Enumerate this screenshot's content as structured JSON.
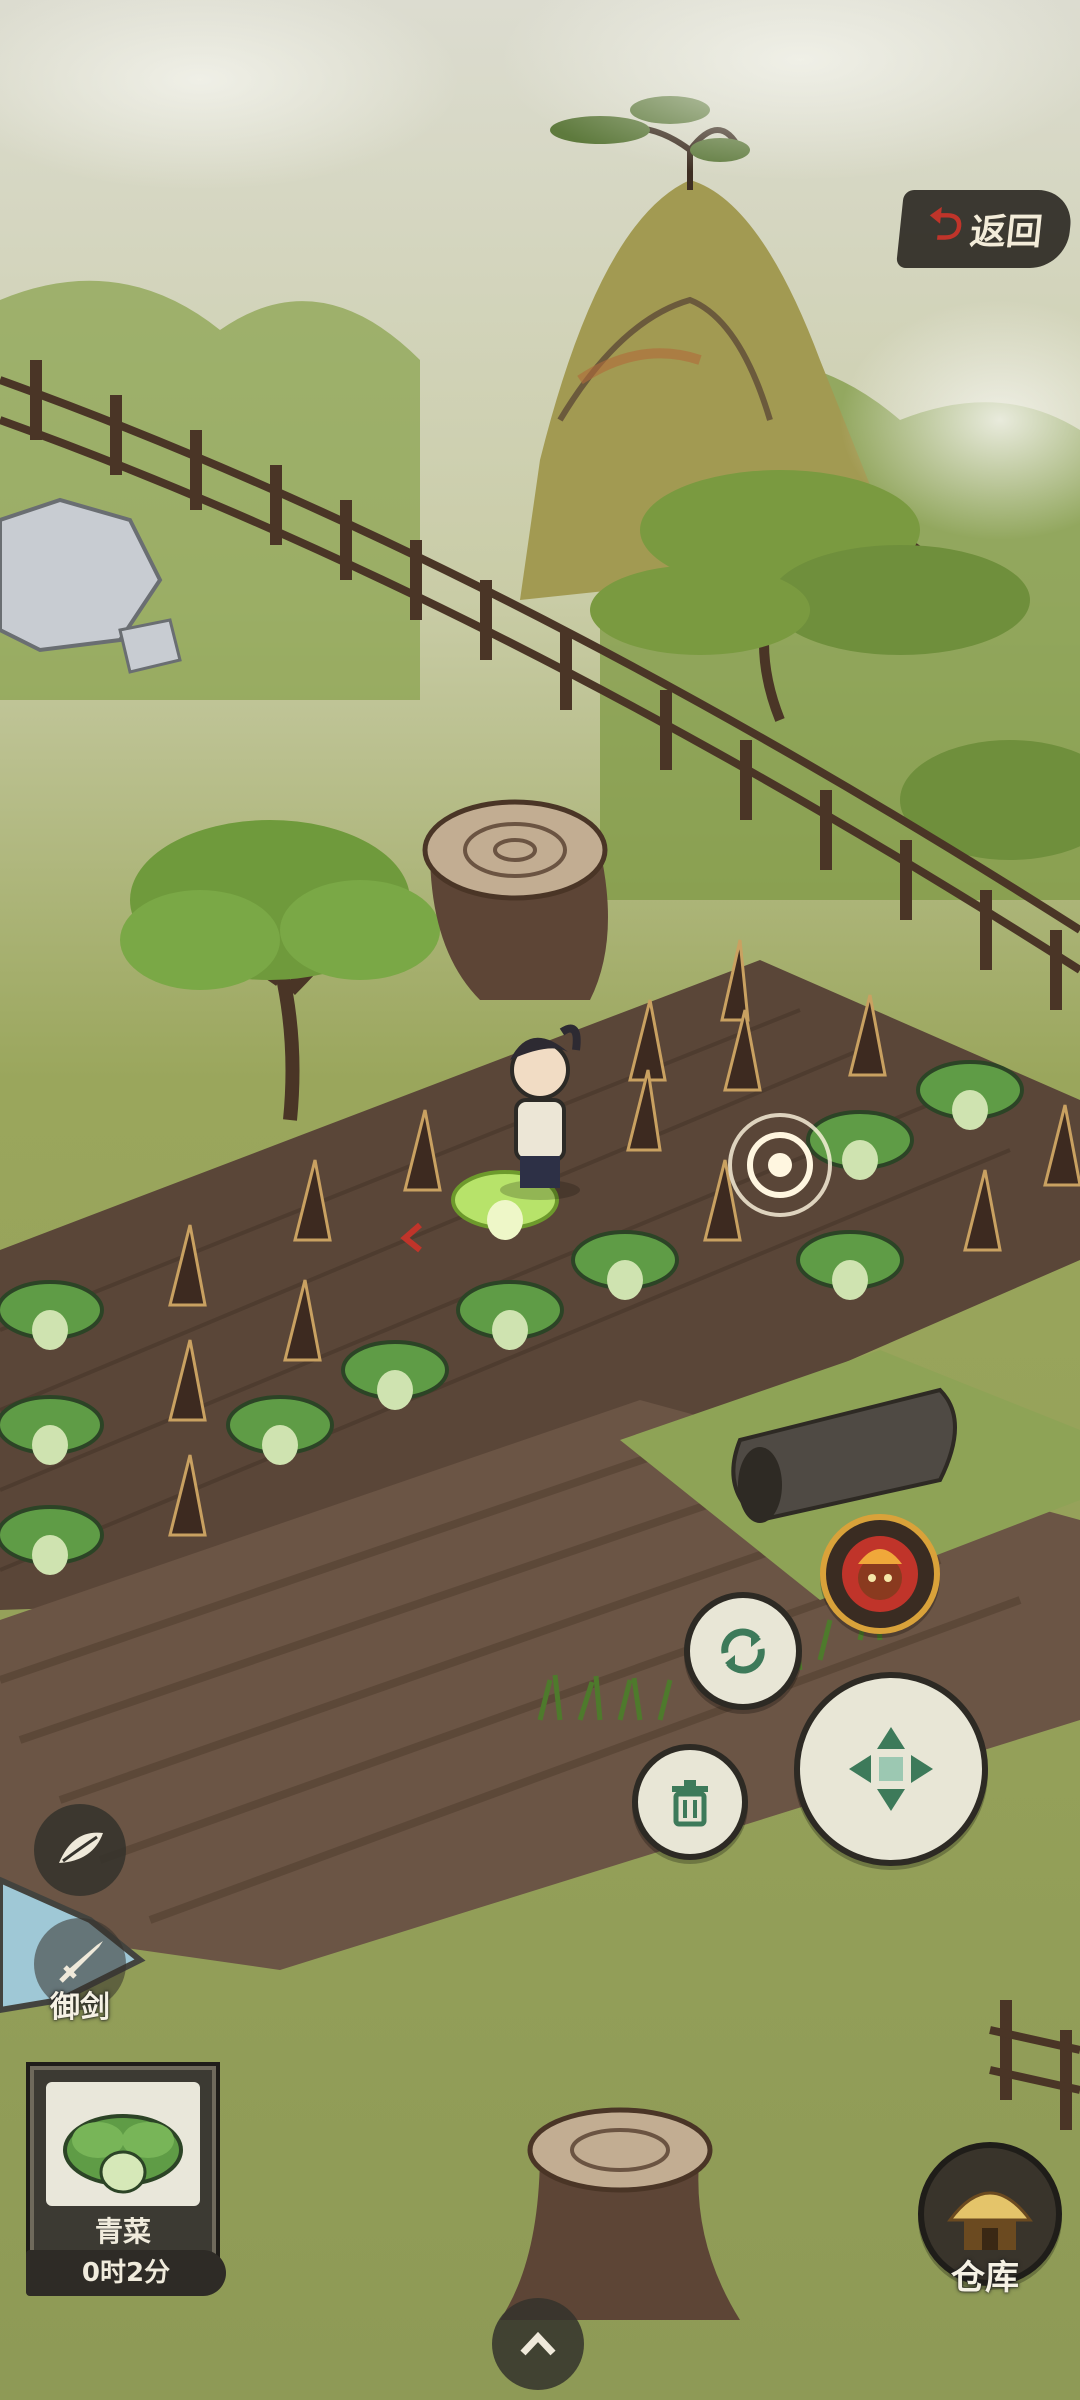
{
  "header": {
    "back_label": "返回"
  },
  "side_actions": {
    "sword_label": "御剑"
  },
  "seed_panel": {
    "crop_name": "青菜",
    "timer": "0时2分"
  },
  "storage": {
    "label": "仓库"
  },
  "icons": {
    "back": "return-arrow-icon",
    "cycle": "refresh-icon",
    "trash": "trash-icon",
    "move": "move-arrows-icon",
    "leaf": "leaf-icon",
    "sword": "sword-icon",
    "up": "chevron-up-icon",
    "hero": "hero-portrait-icon",
    "storehouse": "storehouse-icon"
  },
  "colors": {
    "accent_red": "#c0342a",
    "button_dark": "#2d2a24",
    "button_light": "#e8e6d6",
    "soil": "#5a4638",
    "grass": "#8e9a56"
  }
}
